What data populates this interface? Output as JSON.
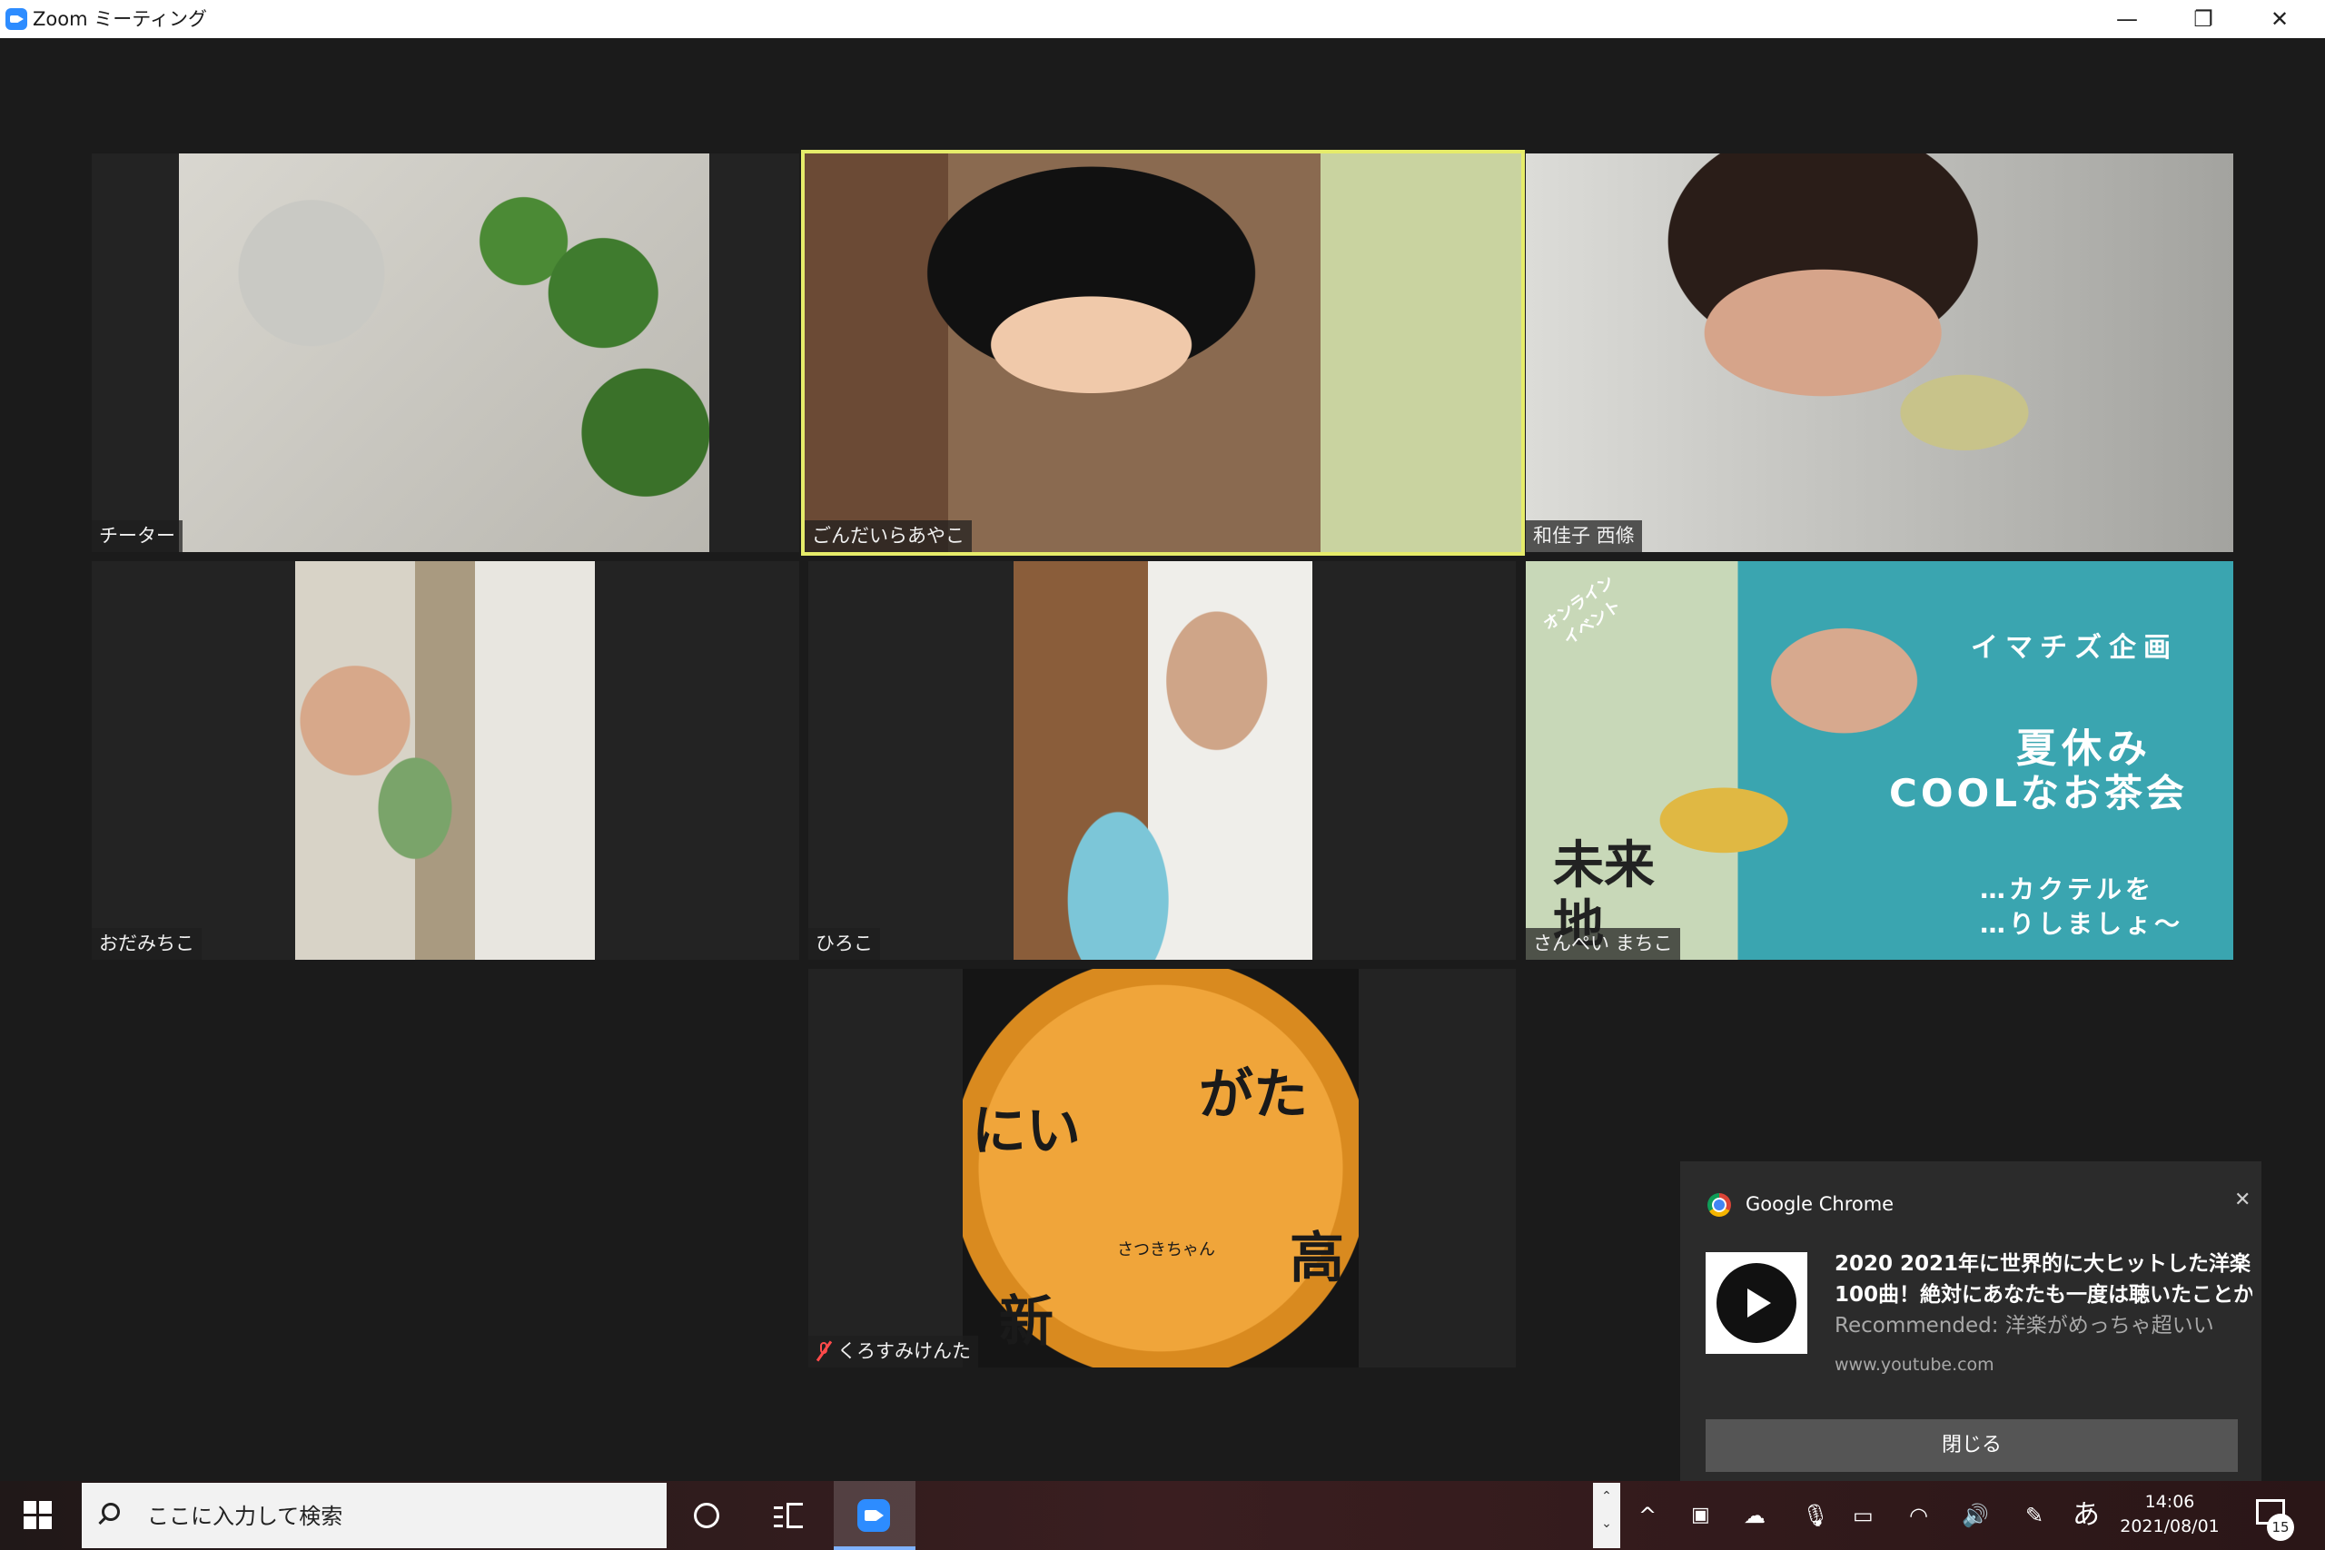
{
  "window": {
    "title": "Zoom ミーティング",
    "minimize": "—",
    "maximize": "❐",
    "close": "✕"
  },
  "colors": {
    "active_speaker": "#e6ec6a",
    "muted_mic": "#ff4a4a",
    "zoom_blue": "#2d8cff"
  },
  "participants": [
    {
      "name": "チーター"
    },
    {
      "name": "ごんだいらあやこ",
      "active_speaker": true
    },
    {
      "name": "和佳子 西條"
    },
    {
      "name": "おだみちこ"
    },
    {
      "name": "ひろこ"
    },
    {
      "name": "さんぺい まちこ"
    },
    {
      "name": "くろすみけんた",
      "muted": true
    }
  ],
  "poster": {
    "event_tag": "オンライン イベント",
    "org": "イマチズ企画",
    "line1": "夏休み",
    "line2": "COOLなお茶会",
    "line3": "…カクテルを",
    "line4": "…りしましょ〜",
    "side1": "未来",
    "side2": "地"
  },
  "seal": {
    "text1": "にい",
    "text2": "がた",
    "text3": "新",
    "text4": "高",
    "mascot": "さつきちゃん"
  },
  "toast": {
    "app": "Google Chrome",
    "headline1": "2020 2021年に世界的に大ヒットした洋楽",
    "headline2": "100曲！絶対にあなたも一度は聴いたことか",
    "recommended": "Recommended: 洋楽がめっちゃ超いい",
    "url": "www.youtube.com",
    "close_button": "閉じる",
    "close_icon": "✕"
  },
  "taskbar": {
    "search_placeholder": "ここに入力して検索",
    "time": "14:06",
    "date": "2021/08/01",
    "notifications": "15",
    "ime": "あ",
    "scroll_up": "⌃",
    "scroll_down": "⌄",
    "tray_chevron": "^"
  }
}
